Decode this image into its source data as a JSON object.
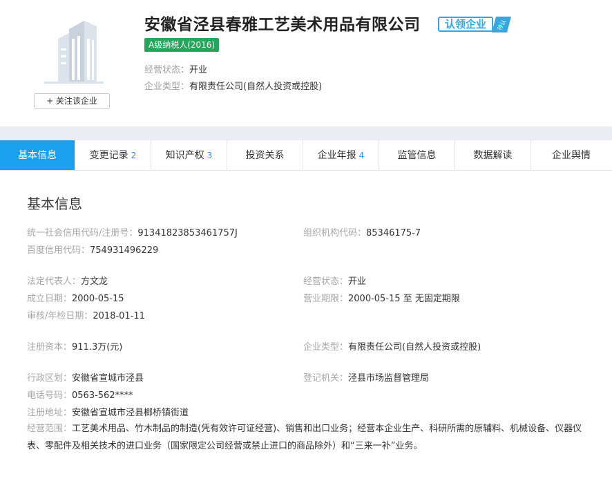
{
  "header": {
    "company_name": "安徽省泾县春雅工艺美术用品有限公司",
    "claim_label": "认领企业",
    "claim_tag": "待认",
    "tax_badge": "A级纳税人(2016)",
    "follow_label": "+ 关注该企业",
    "status_label": "经营状态：",
    "status_value": "开业",
    "type_label": "企业类型：",
    "type_value": "有限责任公司(自然人投资或控股)"
  },
  "tabs": [
    {
      "label": "基本信息",
      "count": ""
    },
    {
      "label": "变更记录",
      "count": "2"
    },
    {
      "label": "知识产权",
      "count": "3"
    },
    {
      "label": "投资关系",
      "count": ""
    },
    {
      "label": "企业年报",
      "count": "4"
    },
    {
      "label": "监管信息",
      "count": ""
    },
    {
      "label": "数据解读",
      "count": ""
    },
    {
      "label": "企业舆情",
      "count": ""
    }
  ],
  "basic": {
    "title": "基本信息",
    "credit_code": {
      "label": "统一社会信用代码/注册号：",
      "value": "91341823853461757J"
    },
    "org_code": {
      "label": "组织机构代码：",
      "value": "85346175-7"
    },
    "baidu_code": {
      "label": "百度信用代码：",
      "value": "754931496229"
    },
    "legal_rep": {
      "label": "法定代表人：",
      "value": "方文龙"
    },
    "biz_status": {
      "label": "经营状态：",
      "value": "开业"
    },
    "found_date": {
      "label": "成立日期：",
      "value": "2000-05-15"
    },
    "biz_term": {
      "label": "营业期限：",
      "value": "2000-05-15 至 无固定期限"
    },
    "audit_date": {
      "label": "审核/年检日期：",
      "value": "2018-01-11"
    },
    "capital": {
      "label": "注册资本：",
      "value": "911.3万(元)"
    },
    "ent_type": {
      "label": "企业类型：",
      "value": "有限责任公司(自然人投资或控股)"
    },
    "region": {
      "label": "行政区划：",
      "value": "安徽省宣城市泾县"
    },
    "authority": {
      "label": "登记机关：",
      "value": "泾县市场监督管理局"
    },
    "phone": {
      "label": "电话号码：",
      "value": "0563-562****"
    },
    "address": {
      "label": "注册地址：",
      "value": "安徽省宣城市泾县榔桥镇街道"
    },
    "scope": {
      "label": "经营范围：",
      "value": "工艺美术用品、竹木制品的制造(凭有效许可证经营)、销售和出口业务；经营本企业生产、科研所需的原辅料、机械设备、仪器仪表、零配件及相关技术的进口业务（国家限定公司经营或禁止进口的商品除外）和“三来一补”业务。"
    }
  },
  "colors": {
    "accent": "#1ba0f0",
    "claim": "#3aa6de",
    "tax_badge": "#26a65b",
    "label_grey": "#a8a8a8"
  }
}
